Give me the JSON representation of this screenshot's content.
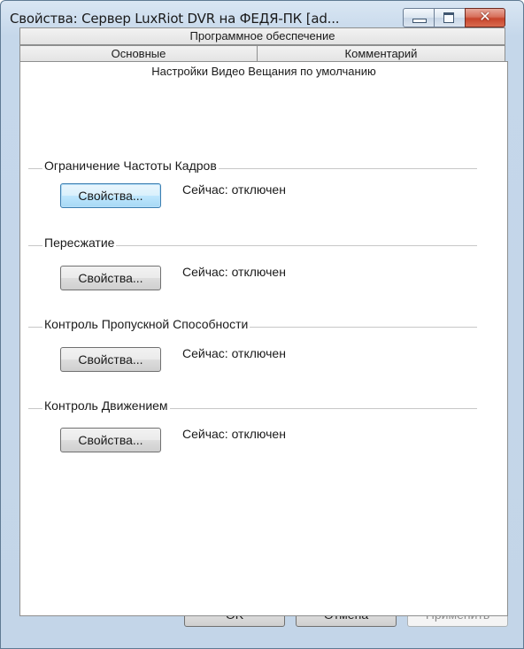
{
  "window": {
    "title": "Свойства: Сервер LuxRiot DVR на ФЕДЯ-ПК [ad...",
    "minimize_icon": "minimize-icon",
    "maximize_icon": "maximize-icon",
    "close_icon": "close-icon",
    "close_glyph": "✕"
  },
  "tabs": {
    "row_top": [
      "Программное обеспечение"
    ],
    "row_middle": [
      "Основные",
      "Комментарий"
    ],
    "active": "Настройки Видео Вещания по умолчанию"
  },
  "groups": [
    {
      "label": "Ограничение Частоты Кадров",
      "button": "Свойства...",
      "status": "Сейчас: отключен"
    },
    {
      "label": "Пересжатие",
      "button": "Свойства...",
      "status": "Сейчас: отключен"
    },
    {
      "label": "Контроль Пропускной Способности",
      "button": "Свойства...",
      "status": "Сейчас: отключен"
    },
    {
      "label": "Контроль Движением",
      "button": "Свойства...",
      "status": "Сейчас: отключен"
    }
  ],
  "footer": {
    "ok": "OK",
    "cancel": "Отмена",
    "apply": "Применить",
    "apply_enabled": false
  },
  "colors": {
    "frame": "#c3d5e8",
    "close_button": "#c7452c",
    "focus_button": "#3c7fb1"
  }
}
